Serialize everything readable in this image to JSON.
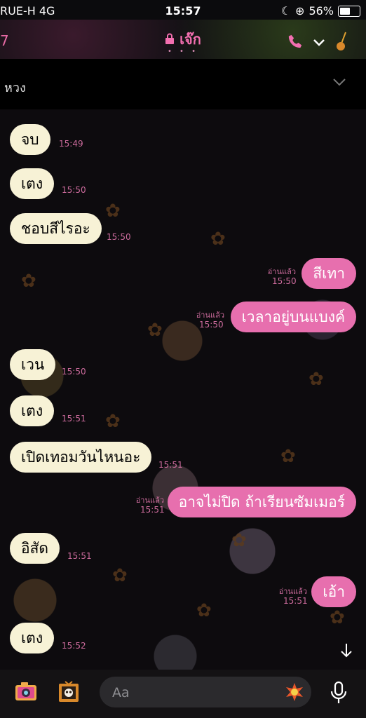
{
  "status": {
    "carrier": "RUE-H  4G",
    "time": "15:57",
    "battery": "56%",
    "battery_level": 0.56
  },
  "header": {
    "back_count": "7",
    "title": "เจ๊ก",
    "dots": "• • •"
  },
  "subheader": {
    "label": "หวง"
  },
  "messages": [
    {
      "side": "in",
      "text": "จบ",
      "time": "15:49"
    },
    {
      "side": "in",
      "text": "เตง",
      "time": "15:50"
    },
    {
      "side": "in",
      "text": "ชอบสีไรอะ",
      "time": "15:50"
    },
    {
      "side": "out",
      "text": "สีเทา",
      "read": "อ่านแล้ว",
      "time": "15:50"
    },
    {
      "side": "out",
      "text": "เวลาอยู่บนแบงค์",
      "read": "อ่านแล้ว",
      "time": "15:50"
    },
    {
      "side": "in",
      "text": "เวน",
      "time": "15:50"
    },
    {
      "side": "in",
      "text": "เตง",
      "time": "15:51"
    },
    {
      "side": "in",
      "text": "เปิดเทอมวันไหนอะ",
      "time": "15:51"
    },
    {
      "side": "out",
      "text": "อาจไม่ปิด ถ้าเรียนซัมเมอร์",
      "read": "อ่านแล้ว",
      "time": "15:51"
    },
    {
      "side": "in",
      "text": "อิสัด",
      "time": "15:51"
    },
    {
      "side": "out",
      "text": "เอ้า",
      "read": "อ่านแล้ว",
      "time": "15:51"
    },
    {
      "side": "in",
      "text": "เตง",
      "time": "15:52"
    }
  ],
  "input": {
    "placeholder": "Aa"
  },
  "icons": {
    "lock": "lock-icon",
    "call": "phone-icon",
    "menu": "chevron-down-icon",
    "guitar": "guitar-icon",
    "camera": "camera-icon",
    "gallery": "image-icon",
    "sticker": "sticker-icon",
    "mic": "microphone-icon",
    "scroll": "arrow-down-icon"
  },
  "colors": {
    "accent": "#e76fae",
    "incoming_bubble": "#f7f2d6",
    "timestamp": "#cc6b9c"
  }
}
